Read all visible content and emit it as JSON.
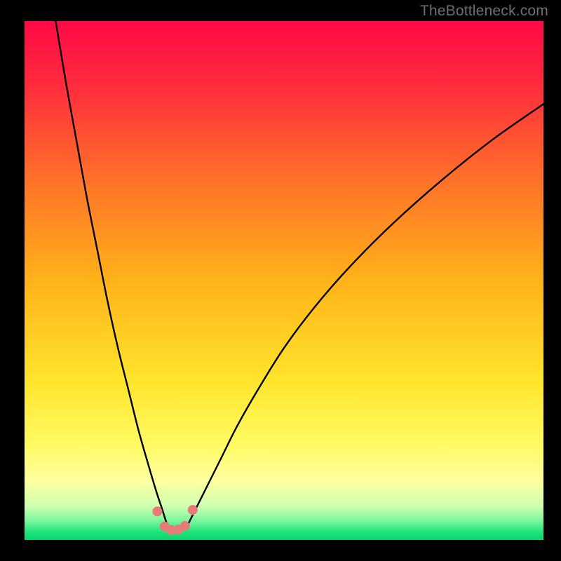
{
  "watermark": "TheBottleneck.com",
  "chart_data": {
    "type": "line",
    "title": "",
    "xlabel": "",
    "ylabel": "",
    "xlim": [
      0,
      100
    ],
    "ylim": [
      0,
      100
    ],
    "grid": false,
    "legend": false,
    "gradient_stops": [
      {
        "pos": 0.0,
        "color": "#ff0a46"
      },
      {
        "pos": 0.12,
        "color": "#ff2a3e"
      },
      {
        "pos": 0.3,
        "color": "#ff6f2a"
      },
      {
        "pos": 0.5,
        "color": "#ffb219"
      },
      {
        "pos": 0.7,
        "color": "#ffe62e"
      },
      {
        "pos": 0.82,
        "color": "#fffb66"
      },
      {
        "pos": 0.885,
        "color": "#ffff9f"
      },
      {
        "pos": 0.935,
        "color": "#cfffb0"
      },
      {
        "pos": 0.962,
        "color": "#7ef79d"
      },
      {
        "pos": 0.985,
        "color": "#1fe47a"
      },
      {
        "pos": 1.0,
        "color": "#06d46a"
      }
    ],
    "series": [
      {
        "name": "left-branch",
        "x": [
          6,
          8,
          10,
          12,
          14,
          16,
          18,
          20,
          22,
          24,
          25.5,
          26.5,
          27.3,
          28
        ],
        "y": [
          100,
          88,
          77,
          66,
          56,
          46,
          37,
          29,
          21,
          14,
          9,
          6,
          3.5,
          2
        ]
      },
      {
        "name": "right-branch",
        "x": [
          31,
          32,
          33.5,
          35.5,
          38,
          41,
          45,
          50,
          56,
          63,
          71,
          80,
          90,
          100
        ],
        "y": [
          2,
          4,
          7,
          11,
          16,
          22,
          29,
          37,
          45,
          53,
          61,
          69,
          77,
          84
        ]
      }
    ],
    "trough_markers": {
      "color": "#e77b78",
      "radius_px": 7,
      "points": [
        {
          "x": 25.6,
          "y": 5.5
        },
        {
          "x": 27.0,
          "y": 2.6
        },
        {
          "x": 28.3,
          "y": 1.9
        },
        {
          "x": 29.6,
          "y": 2.0
        },
        {
          "x": 30.9,
          "y": 2.7
        },
        {
          "x": 32.4,
          "y": 5.8
        }
      ]
    }
  }
}
